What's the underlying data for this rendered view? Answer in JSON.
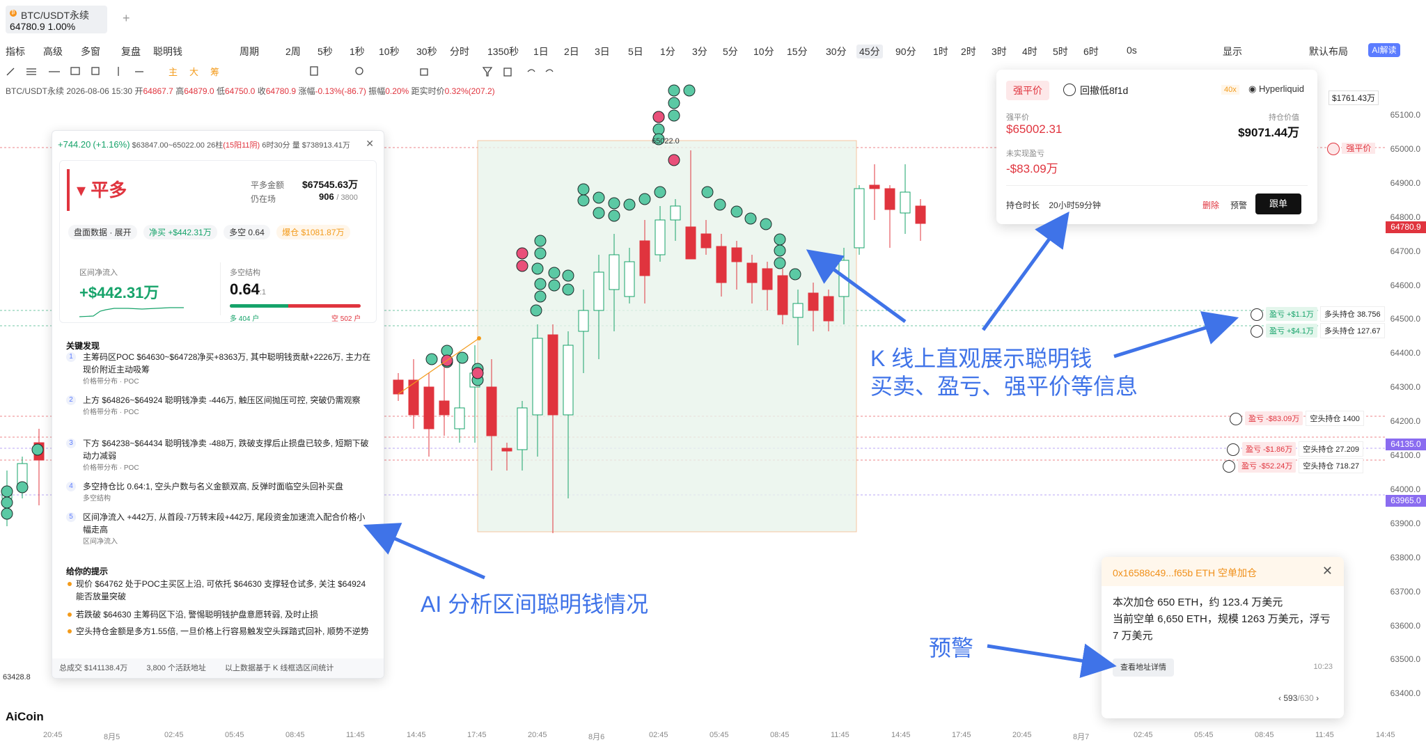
{
  "tab": {
    "title": "BTC/USDT永续",
    "price_line": "64780.9  1.00%"
  },
  "toolbar": {
    "left": [
      "指标",
      "高级",
      "多窗",
      "复盘",
      "聪明钱",
      "周期",
      "2周",
      "5秒",
      "1秒",
      "10秒",
      "30秒",
      "分时",
      "1350秒",
      "1日",
      "2日",
      "3日",
      "5日",
      "1分",
      "3分",
      "5分",
      "10分",
      "15分",
      "30分",
      "45分",
      "90分",
      "1时",
      "2时",
      "3时",
      "4时",
      "5时",
      "6时",
      "0s"
    ],
    "active": "45分",
    "right": [
      "显示",
      "默认布局"
    ],
    "ai": "AI解读"
  },
  "drawing_tools": [
    "主",
    "大",
    "筹"
  ],
  "info": {
    "symbol": "BTC/USDT永续",
    "time": "2026-08-06 15:30",
    "open_l": "开",
    "open": "64867.7",
    "high_l": "高",
    "high": "64879.0",
    "low_l": "低",
    "low": "64750.0",
    "close_l": "收",
    "close": "64780.9",
    "chg_l": "涨幅",
    "chg": "-0.13%(-86.7)",
    "amp_l": "振幅",
    "amp": "0.20%",
    "dist_l": "距实时价",
    "dist": "0.32%(207.2)"
  },
  "yaxis": {
    "ticks": [
      "65100.0",
      "65000.0",
      "64900.0",
      "64800.0",
      "64700.0",
      "64600.0",
      "64500.0",
      "64400.0",
      "64300.0",
      "64200.0",
      "64100.0",
      "64000.0",
      "63900.0",
      "63800.0",
      "63700.0",
      "63600.0",
      "63500.0",
      "63400.0"
    ],
    "tags": [
      {
        "text": "64780.9",
        "color": "#e0343e"
      },
      {
        "text": "64135.0",
        "color": "#8a6cf0"
      },
      {
        "text": "63965.0",
        "color": "#8a6cf0"
      }
    ]
  },
  "xaxis": [
    "20:45",
    "8月5",
    "02:45",
    "05:45",
    "08:45",
    "11:45",
    "14:45",
    "17:45",
    "20:45",
    "8月6",
    "02:45",
    "05:45",
    "08:45",
    "11:45",
    "14:45",
    "17:45",
    "20:45",
    "8月7",
    "02:45",
    "05:45",
    "08:45",
    "11:45",
    "14:45"
  ],
  "chart_marks": {
    "high_label": "65022.0",
    "left_low": "63428.8",
    "top_right_value": "$1761.43万",
    "liq_tag": "强平价"
  },
  "positions": [
    {
      "pl": "盈亏 +$1.1万",
      "size": "多头持仓 38.756",
      "kind": "g"
    },
    {
      "pl": "盈亏 +$4.1万",
      "size": "多头持仓 127.67",
      "kind": "g"
    },
    {
      "pl": "盈亏 -$83.09万",
      "size": "空头持仓 1400",
      "kind": "r"
    },
    {
      "pl": "盈亏 -$1.86万",
      "size": "空头持仓 27.209",
      "kind": "r"
    },
    {
      "pl": "盈亏 -$52.24万",
      "size": "空头持仓 718.27",
      "kind": "r"
    }
  ],
  "panel": {
    "header": {
      "change": "+744.20",
      "pct": "(+1.16%)",
      "range": "$63847.00~65022.00",
      "bars": "26柱",
      "bars_detail": "(15阳11阴)",
      "duration": "6时30分",
      "volume": "量 $738913.41万"
    },
    "direction": "平多",
    "close_amount_label": "平多金额",
    "close_amount": "$67545.63万",
    "in_pos_label": "仍在场",
    "in_pos": "906",
    "in_pos_total": "/ 3800",
    "chips": {
      "disk": "盘面数据 · 展开",
      "net_buy": "净买 +$442.31万",
      "ls": "多空 0.64",
      "liq": "爆仓 $1081.87万"
    },
    "net_inflow_label": "区间净流入",
    "net_inflow": "+$442.31万",
    "ls_label": "多空结构",
    "ls_value": "0.64",
    "ls_unit": ":1",
    "ls_long": "多 404 户",
    "ls_short": "空 502 户",
    "ls_long_frac": 0.446,
    "findings_title": "关键发现",
    "findings": [
      {
        "n": "1",
        "text": "主筹码区POC $64630~$64728净买+8363万, 其中聪明钱贡献+2226万, 主力在现价附近主动吸筹",
        "tag": "价格带分布 · POC"
      },
      {
        "n": "2",
        "text": "上方 $64826~$64924 聪明钱净卖 -446万, 触压区间抛压可控, 突破仍需观察",
        "tag": "价格带分布 · POC"
      },
      {
        "n": "3",
        "text": "下方 $64238~$64434 聪明钱净卖 -488万, 跌破支撑后止损盘已较多, 短期下破动力减弱",
        "tag": "价格带分布 · POC"
      },
      {
        "n": "4",
        "text": "多空持仓比 0.64:1, 空头户数与名义金额双高, 反弹时面临空头回补买盘",
        "tag": "多空结构"
      },
      {
        "n": "5",
        "text": "区间净流入 +442万, 从首段-7万转末段+442万, 尾段资金加速流入配合价格小幅走高",
        "tag": "区间净流入"
      }
    ],
    "tips_title": "给你的提示",
    "tips": [
      "现价 $64762 处于POC主买区上沿, 可依托 $64630 支撑轻仓试多, 关注 $64924 能否放量突破",
      "若跌破 $64630 主筹码区下沿, 警惕聪明钱护盘意愿转弱, 及时止损",
      "空头持仓金额是多方1.55倍, 一旦价格上行容易触发空头踩踏式回补, 顺势不逆势"
    ],
    "footer": {
      "turnover": "总成交 $141138.4万",
      "addresses": "3,800 个活跃地址",
      "note": "以上数据基于 K 线框选区间统计"
    }
  },
  "liq_card": {
    "badge": "强平价",
    "name": "回撤低8f1d",
    "lev": "40x",
    "exchange": "Hyperliquid",
    "liq_price_l": "强平价",
    "liq_price": "$65002.31",
    "value_l": "持仓价值",
    "value": "$9071.44万",
    "upnl_l": "未实现盈亏",
    "upnl": "-$83.09万",
    "dur_l": "持仓时长",
    "dur": "20小时59分钟",
    "del": "删除",
    "warn": "预警",
    "follow": "跟单"
  },
  "alert": {
    "title": "0x16588c49...f65b ETH 空单加仓",
    "body": "本次加仓 650 ETH，约 123.4 万美元\n当前空单 6,650 ETH，规模 1263 万美元，浮亏 7 万美元",
    "button": "查看地址详情",
    "time": "10:23",
    "page": "593",
    "page_total": "/630"
  },
  "annotations": {
    "kline1": "K 线上直观展示聪明钱",
    "kline2": "买卖、盈亏、强平价等信息",
    "ai": "AI 分析区间聪明钱情况",
    "warn": "预警"
  },
  "logo": "AiCoin",
  "colors": {
    "up": "#16a36a",
    "down": "#e0343e",
    "accent": "#3f73e8",
    "brand": "#5b7cff"
  }
}
